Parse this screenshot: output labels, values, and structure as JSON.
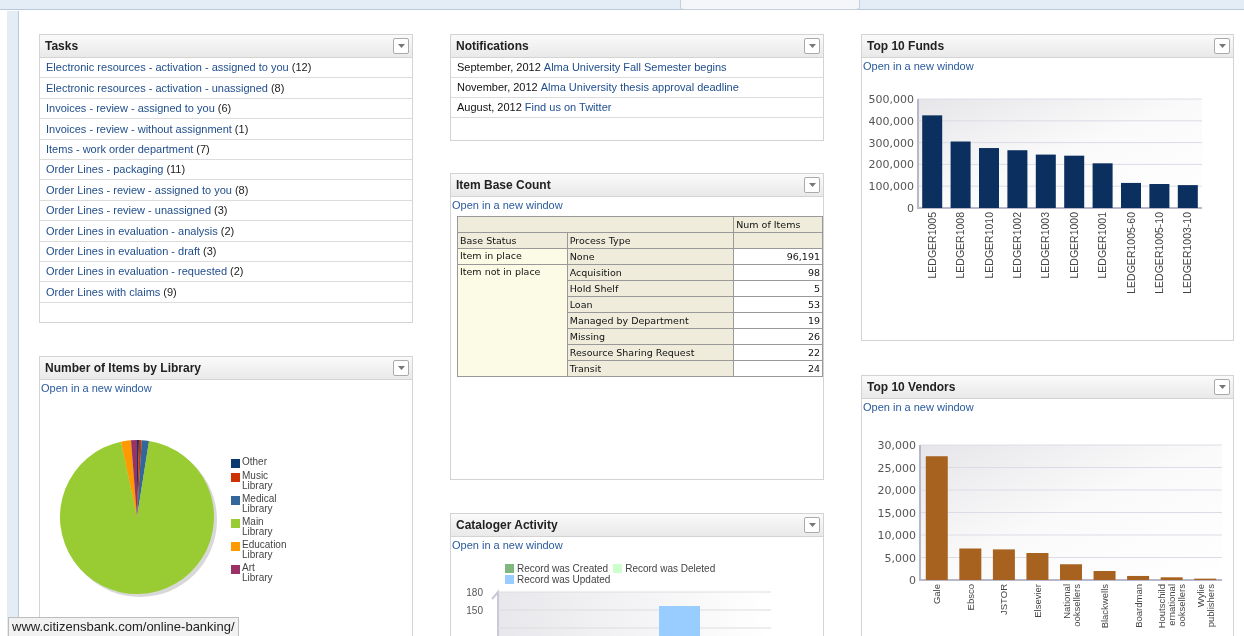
{
  "tasks": {
    "title": "Tasks",
    "items": [
      {
        "label": "Electronic resources - activation - assigned to you",
        "count": "(12)"
      },
      {
        "label": "Electronic resources - activation - unassigned",
        "count": "(8)"
      },
      {
        "label": "Invoices - review - assigned to you",
        "count": "(6)"
      },
      {
        "label": "Invoices - review - without assignment",
        "count": "(1)"
      },
      {
        "label": "Items - work order department",
        "count": "(7)"
      },
      {
        "label": "Order Lines - packaging",
        "count": "(11)"
      },
      {
        "label": "Order Lines - review - assigned to you",
        "count": "(8)"
      },
      {
        "label": "Order Lines - review - unassigned",
        "count": "(3)"
      },
      {
        "label": "Order Lines in evaluation - analysis",
        "count": "(2)"
      },
      {
        "label": "Order Lines in evaluation - draft",
        "count": "(3)"
      },
      {
        "label": "Order Lines in evaluation - requested",
        "count": "(2)"
      },
      {
        "label": "Order Lines with claims",
        "count": "(9)"
      }
    ]
  },
  "library_items": {
    "title": "Number of Items by Library",
    "link": "Open in a new window",
    "legend": [
      {
        "label": "Other",
        "color": "#0b3a6e"
      },
      {
        "label": "Music Library",
        "color": "#cc3300"
      },
      {
        "label": "Medical Library",
        "color": "#336699"
      },
      {
        "label": "Main Library",
        "color": "#99cc33"
      },
      {
        "label": "Education Library",
        "color": "#ff9900"
      },
      {
        "label": "Art Library",
        "color": "#993366"
      }
    ]
  },
  "notifications": {
    "title": "Notifications",
    "items": [
      {
        "date": "September, 2012",
        "link": "Alma University Fall Semester begins"
      },
      {
        "date": "November, 2012",
        "link": "Alma University thesis approval deadline"
      },
      {
        "date": "August, 2012",
        "link": "Find us on Twitter"
      }
    ]
  },
  "item_base_count": {
    "title": "Item Base Count",
    "link": "Open in a new window",
    "measure": "Num of Items",
    "columns": [
      "Base Status",
      "Process Type"
    ],
    "groups": [
      {
        "status": "Item in place",
        "rows": [
          {
            "type": "None",
            "count": "96,191"
          }
        ]
      },
      {
        "status": "Item not in place",
        "rows": [
          {
            "type": "Acquisition",
            "count": "98"
          },
          {
            "type": "Hold Shelf",
            "count": "5"
          },
          {
            "type": "Loan",
            "count": "53"
          },
          {
            "type": "Managed by Department",
            "count": "19"
          },
          {
            "type": "Missing",
            "count": "26"
          },
          {
            "type": "Resource Sharing Request",
            "count": "22"
          },
          {
            "type": "Transit",
            "count": "24"
          }
        ]
      }
    ]
  },
  "cataloger_activity": {
    "title": "Cataloger Activity",
    "link": "Open in a new window",
    "legend": [
      {
        "label": "Record was Created",
        "color": "#7fb77e"
      },
      {
        "label": "Record was Deleted",
        "color": "#ccffcc"
      },
      {
        "label": "Record was Updated",
        "color": "#99ccff"
      }
    ],
    "axis_labels": [
      "180",
      "150"
    ]
  },
  "top_funds": {
    "title": "Top 10 Funds",
    "link": "Open in a new window",
    "chart_data": {
      "type": "bar",
      "categories": [
        "LEDGER1005",
        "LEDGER1008",
        "LEDGER1010",
        "LEDGER1002",
        "LEDGER1003",
        "LEDGER1000",
        "LEDGER1001",
        "LEDGER1005-60",
        "LEDGER1005-10",
        "LEDGER1003-10"
      ],
      "series": [
        {
          "color": "#0b2f5e",
          "values": [
            425000,
            305000,
            275000,
            265000,
            245000,
            240000,
            205000,
            115000,
            110000,
            105000
          ]
        }
      ],
      "grid": true,
      "ylim": [
        0,
        500000
      ],
      "yticks": [
        {
          "value": 0,
          "label": "0"
        },
        {
          "value": 100000,
          "label": "100,000"
        },
        {
          "value": 200000,
          "label": "200,000"
        },
        {
          "value": 300000,
          "label": "300,000"
        },
        {
          "value": 400000,
          "label": "400,000"
        },
        {
          "value": 500000,
          "label": "500,000"
        }
      ]
    }
  },
  "top_vendors": {
    "title": "Top 10 Vendors",
    "link": "Open in a new window",
    "chart_data": {
      "type": "bar",
      "categories": [
        "Gale",
        "Ebsco",
        "JSTOR",
        "Elsevier",
        "National ooksellers",
        "Blackwells",
        "Boardman",
        "Houtschild ernational ooksellers",
        "Wylie publishers"
      ],
      "series": [
        {
          "color": "#a8621f",
          "values": [
            27500,
            7000,
            6800,
            6000,
            3500,
            2000,
            900,
            600,
            300
          ]
        }
      ],
      "grid": true,
      "ylim": [
        0,
        30000
      ],
      "yticks": [
        {
          "value": 0,
          "label": "0"
        },
        {
          "value": 5000,
          "label": "5,000"
        },
        {
          "value": 10000,
          "label": "10,000"
        },
        {
          "value": 15000,
          "label": "15,000"
        },
        {
          "value": 20000,
          "label": "20,000"
        },
        {
          "value": 25000,
          "label": "25,000"
        },
        {
          "value": 30000,
          "label": "30,000"
        }
      ]
    }
  },
  "status_bar": {
    "url": "www.citizensbank.com/online-banking/"
  }
}
